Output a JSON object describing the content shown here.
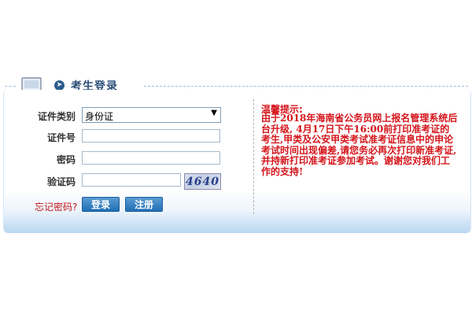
{
  "header": {
    "title": "考生登录"
  },
  "form": {
    "id_type_label": "证件类别",
    "id_type_value": "身份证",
    "id_number_label": "证件号",
    "password_label": "密码",
    "captcha_label": "验证码",
    "captcha_image_text": "4640",
    "forgot_password": "忘记密码?",
    "login_button": "登录",
    "register_button": "注册"
  },
  "notice": {
    "title": "温馨提示:",
    "body": "由于2018年海南省公务员网上报名管理系统后台升级, 4月17日下午16:00前打印准考证的考生,甲类及公安甲类考试准考证信息中的申论考试时间出现偏差,请您务必再次打印新准考证,并持新打印准考证参加考试。谢谢您对我们工作的支持!"
  },
  "icons": {
    "panel_icon": "computer-icon",
    "title_bullet": "circle-arrow-icon"
  },
  "colors": {
    "title_blue": "#2b4e78",
    "notice_red": "#d4151b",
    "button_blue": "#1f6eb3"
  }
}
